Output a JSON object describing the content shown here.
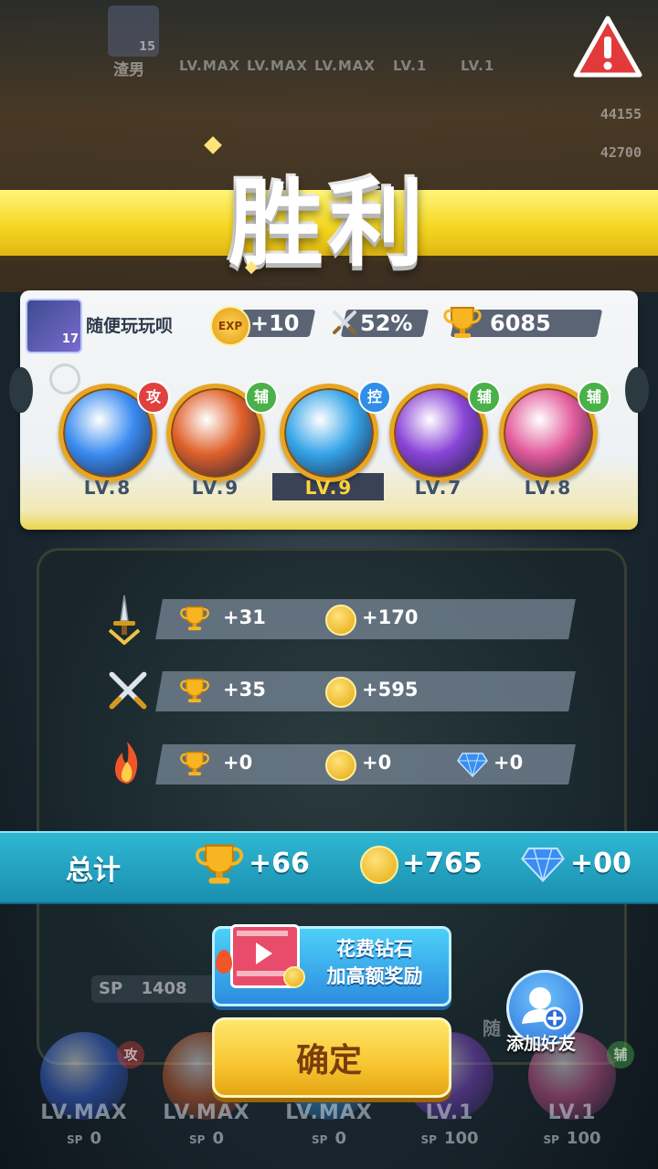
{
  "top_strip": {
    "player_label": "渣男",
    "player_badge": "15",
    "levels": [
      "LV.MAX",
      "LV.MAX",
      "LV.MAX",
      "LV.1",
      "LV.1"
    ],
    "side_scores": [
      "44155",
      "42700"
    ]
  },
  "banner": {
    "title": "胜利"
  },
  "player": {
    "avatar_level": "17",
    "name": "随便玩玩呗",
    "exp": "+10",
    "win_rate": "52%",
    "trophies": "6085"
  },
  "heroes": [
    {
      "level": "LV.8",
      "role": "攻",
      "role_color": "#e0413f",
      "orb_color": "#3a8cf0",
      "selected": false
    },
    {
      "level": "LV.9",
      "role": "辅",
      "role_color": "#49b148",
      "orb_color": "#e0602a",
      "selected": false
    },
    {
      "level": "LV.9",
      "role": "控",
      "role_color": "#2f8ee8",
      "orb_color": "#35a4e8",
      "selected": true
    },
    {
      "level": "LV.7",
      "role": "辅",
      "role_color": "#49b148",
      "orb_color": "#8a45d8",
      "selected": false
    },
    {
      "level": "LV.8",
      "role": "辅",
      "role_color": "#49b148",
      "orb_color": "#e25a9a",
      "selected": false
    }
  ],
  "rewards": {
    "row1": {
      "trophies": "+31",
      "coins": "+170"
    },
    "row2": {
      "trophies": "+35",
      "coins": "+595"
    },
    "row3": {
      "trophies": "+0",
      "coins": "+0",
      "gems": "+0"
    }
  },
  "total": {
    "label": "总计",
    "trophies": "+66",
    "coins": "+765",
    "gems": "+00"
  },
  "buttons": {
    "diamond_line1": "花费钻石",
    "diamond_line2": "加高额奖励",
    "confirm": "确定",
    "add_friend": "添加好友"
  },
  "bottom": {
    "sp_value": "1408",
    "levels": [
      "LV.MAX",
      "LV.MAX",
      "LV.MAX",
      "LV.1",
      "LV.1"
    ],
    "sp_values": [
      "0",
      "0",
      "0",
      "100",
      "100"
    ],
    "sp_label": "SP",
    "role_left": "攻",
    "role_right": "辅",
    "partial_name": "随"
  },
  "colors": {
    "banner_yellow": "#f5d823",
    "total_bar": "#1a8fb0",
    "confirm_button": "#f7c530",
    "diamond_button": "#2c8cdf"
  }
}
